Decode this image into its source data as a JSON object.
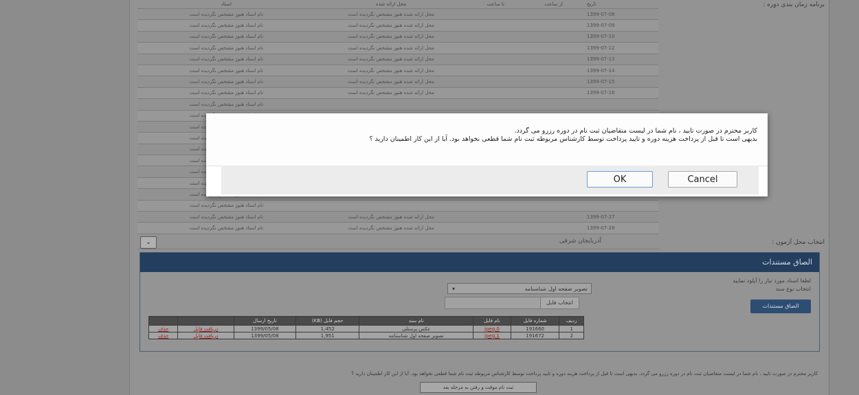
{
  "schedule": {
    "headers": {
      "professor": "استاد",
      "place": "محل ارائه شده",
      "to_time": "تا ساعت",
      "from_time": "از ساعت",
      "date": "تاریخ"
    },
    "side_label": "برنامه زمان بندی دوره :",
    "rows": [
      {
        "professor": "نام استاد هنوز مشخص نگردیده است",
        "place": "محل ارائه شده هنوز مشخص نگردیده است",
        "date": "1399-07-08"
      },
      {
        "professor": "نام استاد هنوز مشخص نگردیده است",
        "place": "محل ارائه شده هنوز مشخص نگردیده است",
        "date": "1399-07-09"
      },
      {
        "professor": "نام استاد هنوز مشخص نگردیده است",
        "place": "محل ارائه شده هنوز مشخص نگردیده است",
        "date": "1399-07-10"
      },
      {
        "professor": "نام استاد هنوز مشخص نگردیده است",
        "place": "محل ارائه شده هنوز مشخص نگردیده است",
        "date": "1399-07-12"
      },
      {
        "professor": "نام استاد هنوز مشخص نگردیده است",
        "place": "محل ارائه شده هنوز مشخص نگردیده است",
        "date": "1399-07-13"
      },
      {
        "professor": "نام استاد هنوز مشخص نگردیده است",
        "place": "محل ارائه شده هنوز مشخص نگردیده است",
        "date": "1399-07-14"
      },
      {
        "professor": "نام استاد هنوز مشخص نگردیده است",
        "place": "محل ارائه شده هنوز مشخص نگردیده است",
        "date": "1399-07-15"
      },
      {
        "professor": "نام استاد هنوز مشخص نگردیده است",
        "place": "محل ارائه شده هنوز مشخص نگردیده است",
        "date": "1399-07-16"
      },
      {
        "professor": "نام استاد هنوز مشخص نگردیده است",
        "place": "",
        "date": ""
      },
      {
        "professor": "نام استاد هنوز مشخص نگردیده است",
        "place": "",
        "date": ""
      },
      {
        "professor": "نام استاد هنوز مشخص نگردیده است",
        "place": "",
        "date": ""
      },
      {
        "professor": "نام استاد هنوز مشخص نگردیده است",
        "place": "",
        "date": ""
      },
      {
        "professor": "نام استاد هنوز مشخص نگردیده است",
        "place": "",
        "date": ""
      },
      {
        "professor": "نام استاد هنوز مشخص نگردیده است",
        "place": "",
        "date": ""
      },
      {
        "professor": "نام استاد هنوز مشخص نگردیده است",
        "place": "",
        "date": ""
      },
      {
        "professor": "نام استاد هنوز مشخص نگردیده است",
        "place": "",
        "date": ""
      },
      {
        "professor": "نام استاد هنوز مشخص نگردیده است",
        "place": "",
        "date": ""
      },
      {
        "professor": "نام استاد هنوز مشخص نگردیده است",
        "place": "",
        "date": ""
      },
      {
        "professor": "نام استاد هنوز مشخص نگردیده است",
        "place": "محل ارائه شده هنوز مشخص نگردیده است",
        "date": "1399-07-27"
      },
      {
        "professor": "نام استاد هنوز مشخص نگردیده است",
        "place": "محل ارائه شده هنوز مشخص نگردیده است",
        "date": "1399-07-28"
      }
    ]
  },
  "exam_place": {
    "label": "انتخاب محل آزمون :",
    "value": "آذربایجان شرقی",
    "dropdown_glyph": "⌄"
  },
  "attachments": {
    "title": "الصاق مستندات",
    "hint1": "لطفا اسناد مورد نیاز را آپلود نمایید",
    "hint2": "انتخاب نوع سند",
    "doc_type": "تصویر صفحه اول شناسنامه",
    "choose_file": "انتخاب فایل",
    "upload_button": "الصاق مستندات",
    "columns": [
      "ردیف",
      "شماره فایل",
      "نام فایل",
      "نام سند",
      "حجم فایل (KB)",
      "تاریخ ارسال",
      "",
      ""
    ],
    "rows": [
      [
        "1",
        "191660",
        "jpeg.0",
        "عکس پرسنلی",
        "1,452",
        "1399/05/08",
        "دریافت فایل",
        "حذف"
      ],
      [
        "2",
        "191672",
        "jpeg.1",
        "تصویر صفحه اول شناسنامه",
        "1,951",
        "1399/05/08",
        "دریافت فایل",
        "حذف"
      ]
    ]
  },
  "notice_text": "کاربر محترم در صورت تایید ، نام شما در لیست متقاضیان ثبت نام در دوره رزرو می گردد. بدیهی است تا قبل از پرداخت هزینه دوره و تایید پرداخت توسط کارشناس مربوطه ثبت نام شما قطعی نخواهد بود. آیا از این کار اطمینان دارید ؟",
  "next_button": "ثبت نام موقت و رفتن به مرحله بعد",
  "dialog": {
    "line1": "کاربر محترم در صورت تایید ، نام شما در لیست متقاضیان ثبت نام در دوره رزرو می گردد.",
    "line2": "بدیهی است تا قبل از پرداخت هزینه دوره و تایید پرداخت توسط کارشناس مربوطه ثبت نام شما قطعی نخواهد بود. آیا از این کار اطمینان دارید ؟",
    "ok_label": "OK",
    "cancel_label": "Cancel"
  }
}
